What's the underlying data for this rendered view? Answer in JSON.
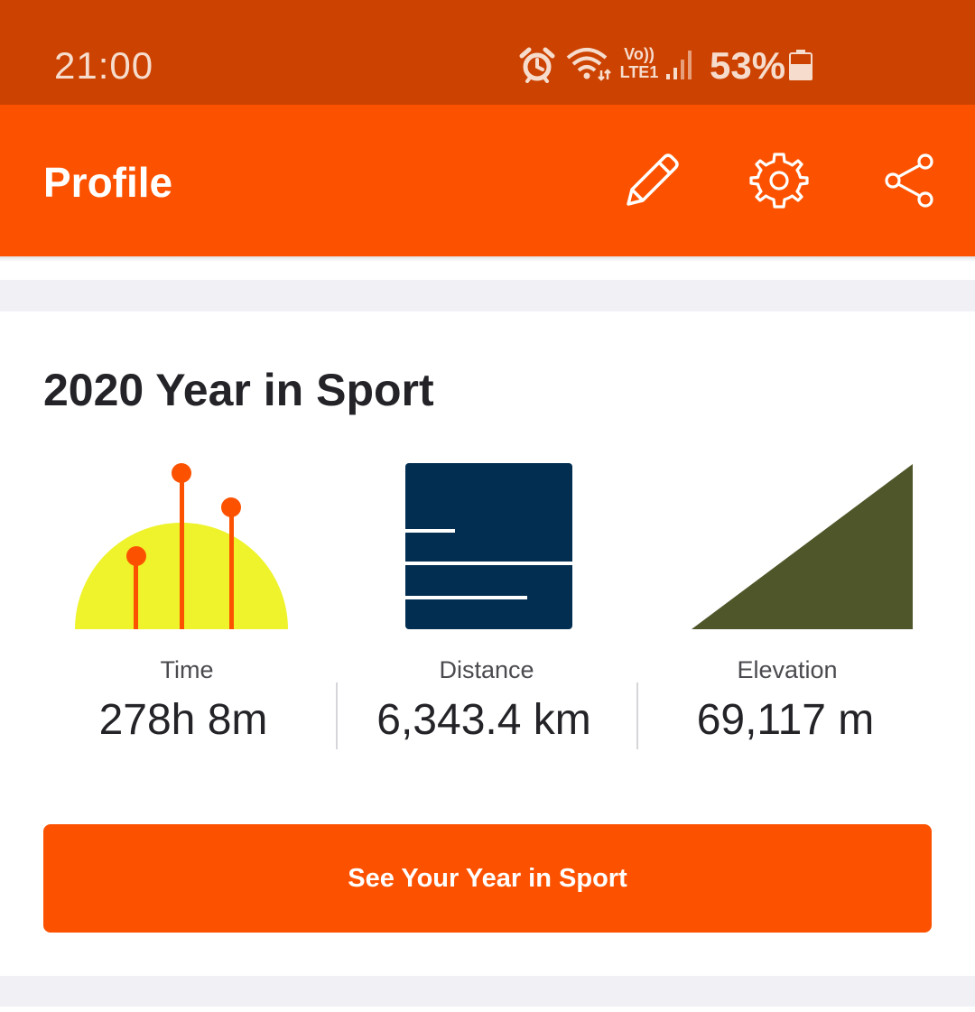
{
  "status_bar": {
    "time": "21:00",
    "battery_percent": "53%",
    "network_label_top": "Vo))",
    "network_label_bottom": "LTE1",
    "icons": [
      "alarm-icon",
      "wifi-icon",
      "volte-icon",
      "signal-icon",
      "battery-icon"
    ]
  },
  "app_bar": {
    "title": "Profile",
    "actions": [
      "edit-icon",
      "settings-gear-icon",
      "share-icon"
    ]
  },
  "year_in_sport": {
    "title": "2020 Year in Sport",
    "stats": [
      {
        "label": "Time",
        "value": "278h 8m",
        "illustration": "time-sunrise-illustration"
      },
      {
        "label": "Distance",
        "value": "6,343.4 km",
        "illustration": "distance-lanes-illustration"
      },
      {
        "label": "Elevation",
        "value": "69,117 m",
        "illustration": "elevation-slope-illustration"
      }
    ],
    "cta_label": "See Your Year in Sport"
  },
  "colors": {
    "status_bar": "#cc4200",
    "brand_orange": "#fc5200",
    "sun_yellow": "#eef32b",
    "distance_navy": "#022e52",
    "elevation_olive": "#4f5629"
  }
}
